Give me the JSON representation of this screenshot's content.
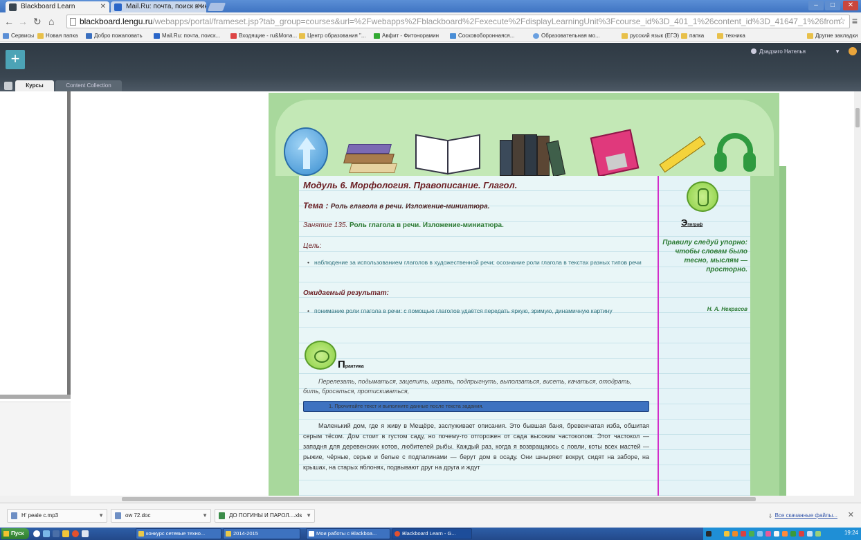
{
  "browser": {
    "tabs": [
      {
        "title": "Blackboard Learn",
        "active": true
      },
      {
        "title": "Mail.Ru: почта, поиск в инт",
        "active": false
      }
    ],
    "url_host": "blackboard.lengu.ru",
    "url_path": "/webapps/portal/frameset.jsp?tab_group=courses&url=%2Fwebapps%2Fblackboard%2Fexecute%2FdisplayLearningUnit%3Fcourse_id%3D_401_1%26content_id%3D_41647_1%26from",
    "bookmarks": [
      "Сервисы",
      "Новая папка",
      "Добро пожаловать",
      "Mail.Ru: почта, поиск...",
      "Входящие - ru&Mona...",
      "Центр образования \"...",
      "Авфит - Фитонорамин",
      "Сосковобороннаяся...",
      "Образовательная мо...",
      "русский язык (ЕГЭ)",
      "папка",
      "техника",
      "Другие закладки"
    ]
  },
  "blackboard": {
    "user": "Дзадзиго Нателья",
    "tabs": [
      "Курсы",
      "Content Collection"
    ]
  },
  "lesson": {
    "module_title": "Модуль 6. Морфология. Правописание. Глагол.",
    "topic_lead": "Тема : ",
    "topic_text": "Роль глагола в речи. Изложение-миниатюра.",
    "lesson_num": "Занятие 135.",
    "lesson_text": " Роль глагола в речи. Изложение-миниатюра.",
    "goal_heading": "Цель:",
    "goal_item": "наблюдение за использованием глаголов в художественной речи; осознание роли глагола в текстах разных типов речи",
    "result_heading": "Ожидаемый результат:",
    "result_item": "понимание роли глагола в речи: с помощью глаголов удаётся передать яркую, зримую, динамичную картину",
    "practice_big": "П",
    "practice_small": "рактика",
    "practice_words": "Перелезать, подыматься, зацепить, играть, подпрыгнуть, выползаться, висеть, качаться, отодрать, бить, бросаться, протискиваться,",
    "task": "1. Прочитайте текст и выполните данные после текста задания.",
    "text": "Маленький дом, где я живу в Мещёре, заслуживает описания. Это бывшая баня, бревенчатая изба, обшитая серым тёсом. Дом стоит в густом саду, но почему-то отгорожен от сада высоким частоколом. Этот частокол — западня для деревенских котов, любителей рыбы. Каждый раз, когда я возвращаюсь с ловли, коты всех мастей — рыжие, чёрные, серые и белые с подпалинами — берут дом в осаду. Они шныряют вокруг, сидят на заборе, на крышах, на старых яблонях, подвывают друг на друга и ждут",
    "epigraph_big": "Э",
    "epigraph_small": "пиграф",
    "epigraph_text": "Правилу следуй упорно: чтобы словам было тесно, мыслям — просторно.",
    "epigraph_author": "Н. А. Некрасов"
  },
  "downloads": {
    "items": [
      "Н' peale c.mp3",
      "ow 72.doc",
      "ДО ПОГИНЫ И ПАРОЛ....xls"
    ],
    "show_all": "Все скачанные файлы..."
  },
  "taskbar": {
    "start": "Пуск",
    "tasks": [
      "конкурс сетевые техно...",
      "2014-2015",
      "Мои работы с Blackboa...",
      "Blackboard Learn - G..."
    ],
    "clock": "19:24"
  },
  "colors": {
    "chrome_title": "#3f74c2",
    "bb_header": "#3a4651",
    "content_green": "#a8d89c",
    "title_red": "#6b1f24",
    "green_text": "#2b7a33",
    "margin_line": "#d22ec9"
  }
}
